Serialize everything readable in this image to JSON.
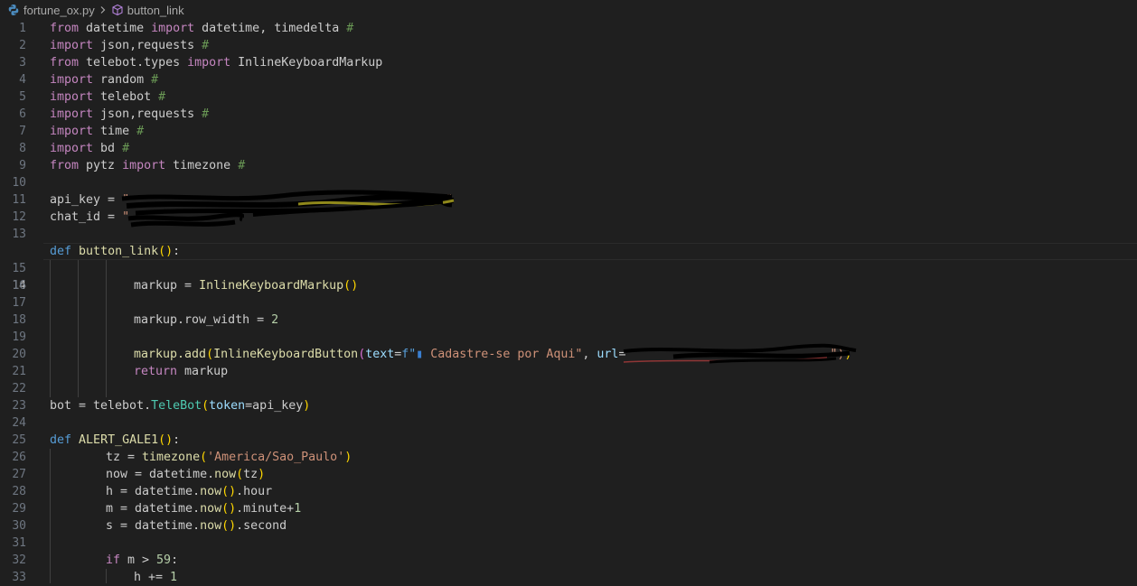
{
  "breadcrumb": {
    "file": "fortune_ox.py",
    "symbol": "button_link"
  },
  "gutter": {
    "numbers": [
      "1",
      "2",
      "3",
      "4",
      "5",
      "6",
      "7",
      "8",
      "9",
      "10",
      "11",
      "12",
      "13",
      "14",
      "15",
      "16",
      "17",
      "18",
      "19",
      "20",
      "21",
      "22",
      "23",
      "24",
      "25",
      "26",
      "27",
      "28",
      "29",
      "30",
      "31",
      "32",
      "33"
    ],
    "active_line": 14
  },
  "code": {
    "l1": [
      "from",
      " datetime ",
      "import",
      " datetime, timedelta ",
      "#"
    ],
    "l2": [
      "import",
      " json,requests ",
      "#"
    ],
    "l3": [
      "from",
      " telebot.types ",
      "import",
      " InlineKeyboardMarkup"
    ],
    "l4": [
      "import",
      " random ",
      "#"
    ],
    "l5": [
      "import",
      " telebot ",
      "#"
    ],
    "l6": [
      "import",
      " json,requests ",
      "#"
    ],
    "l7": [
      "import",
      " time ",
      "#"
    ],
    "l8": [
      "import",
      " bd ",
      "#"
    ],
    "l9": [
      "from",
      " pytz ",
      "import",
      " timezone ",
      "#"
    ],
    "l11": [
      "api_key = ",
      "\"",
      "\""
    ],
    "l12": [
      "chat_id = ",
      "\""
    ],
    "l14": [
      "def",
      " ",
      "button_link",
      "(",
      ")",
      ":"
    ],
    "l16": [
      "markup = ",
      "InlineKeyboardMarkup",
      "(",
      ")"
    ],
    "l18": [
      "markup.row_width = ",
      "2"
    ],
    "l20": [
      "markup.add",
      "(",
      "InlineKeyboardButton",
      "(",
      "text",
      "=",
      "f\"",
      " Cadastre-se por Aqui\"",
      ", ",
      "url",
      "= ",
      "\")",
      ")"
    ],
    "l21": [
      "return",
      " markup"
    ],
    "l23": [
      "bot = telebot.",
      "TeleBot",
      "(",
      "token",
      "=api_key",
      ")"
    ],
    "l25": [
      "def",
      " ",
      "ALERT_GALE1",
      "(",
      ")",
      ":"
    ],
    "l26": [
      "tz = ",
      "timezone",
      "(",
      "'America/Sao_Paulo'",
      ")"
    ],
    "l27": [
      "now = datetime.",
      "now",
      "(",
      "tz",
      ")"
    ],
    "l28": [
      "h = datetime.",
      "now",
      "(",
      ")",
      ".hour"
    ],
    "l29": [
      "m = datetime.",
      "now",
      "(",
      ")",
      ".minute+",
      "1"
    ],
    "l30": [
      "s = datetime.",
      "now",
      "(",
      ")",
      ".second"
    ],
    "l32": [
      "if",
      " m > ",
      "59",
      ":"
    ],
    "l33": [
      "h += ",
      "1"
    ]
  },
  "colors": {
    "background": "#1f1f1f",
    "keyword": "#c586c0",
    "def_keyword": "#569cd6",
    "function": "#dcdcaa",
    "string": "#ce9178",
    "comment": "#6a9955",
    "number": "#b5cea8"
  },
  "icons": {
    "file": "python-icon",
    "separator": "chevron-right-icon",
    "symbol": "cube-method-icon"
  }
}
